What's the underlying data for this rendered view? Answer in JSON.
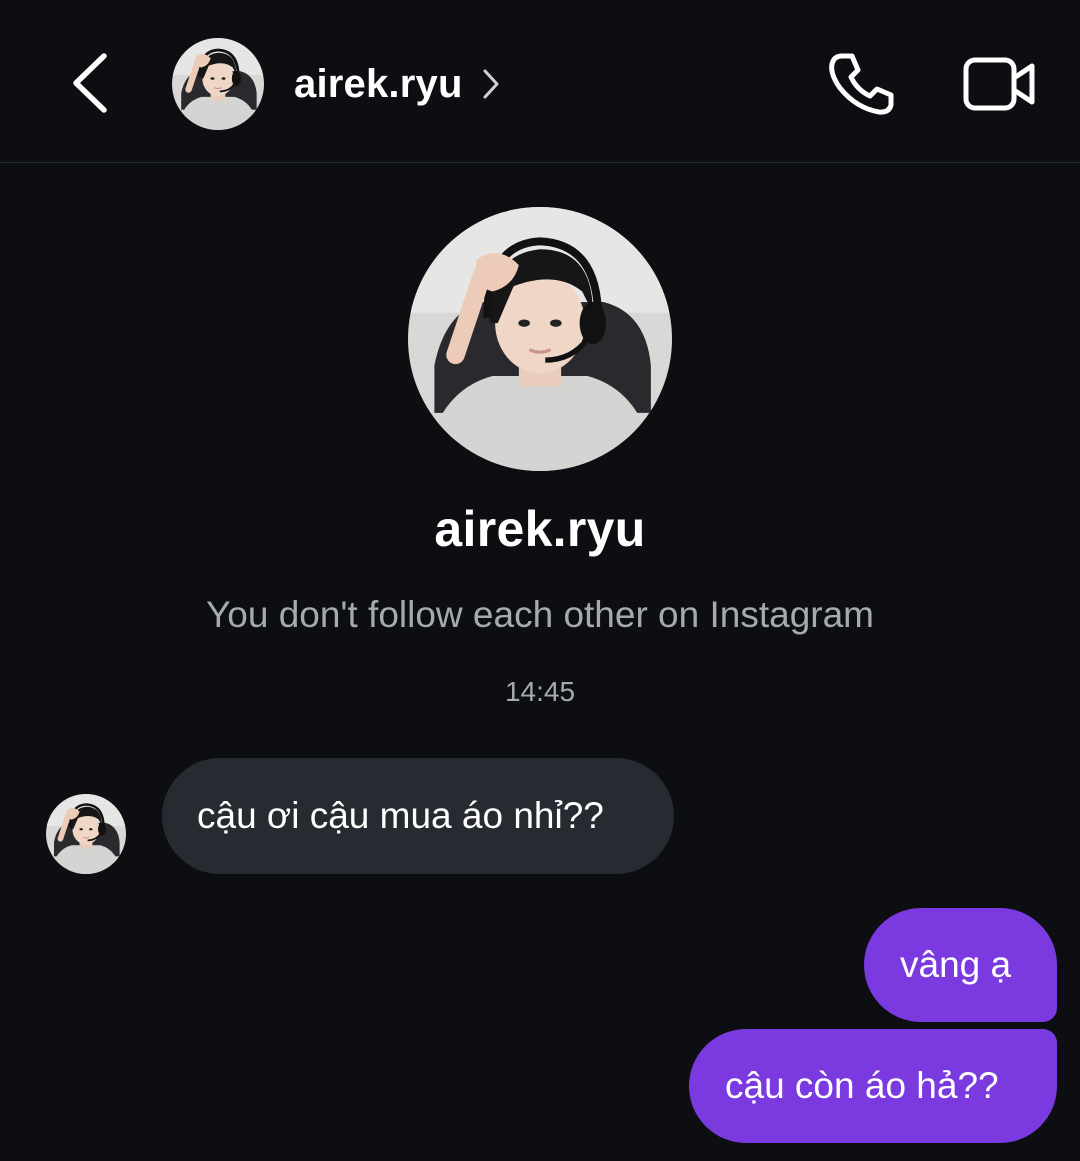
{
  "header": {
    "back_icon": "chevron-left-icon",
    "username": "airek.ryu",
    "username_chevron_icon": "chevron-right-icon",
    "call_icon": "phone-icon",
    "video_icon": "video-camera-icon"
  },
  "profile": {
    "username": "airek.ryu",
    "follow_status": "You don't follow each other on Instagram"
  },
  "thread": {
    "timestamp": "14:45",
    "messages": [
      {
        "direction": "incoming",
        "text": "cậu ơi cậu mua áo nhỉ??"
      },
      {
        "direction": "outgoing",
        "text": "vâng ạ"
      },
      {
        "direction": "outgoing",
        "text": "cậu còn áo hả??"
      }
    ]
  },
  "colors": {
    "background": "#0c0e12",
    "incoming_bubble": "#262a31",
    "outgoing_bubble": "#7a3ae0",
    "secondary_text": "#a6a9b0"
  }
}
